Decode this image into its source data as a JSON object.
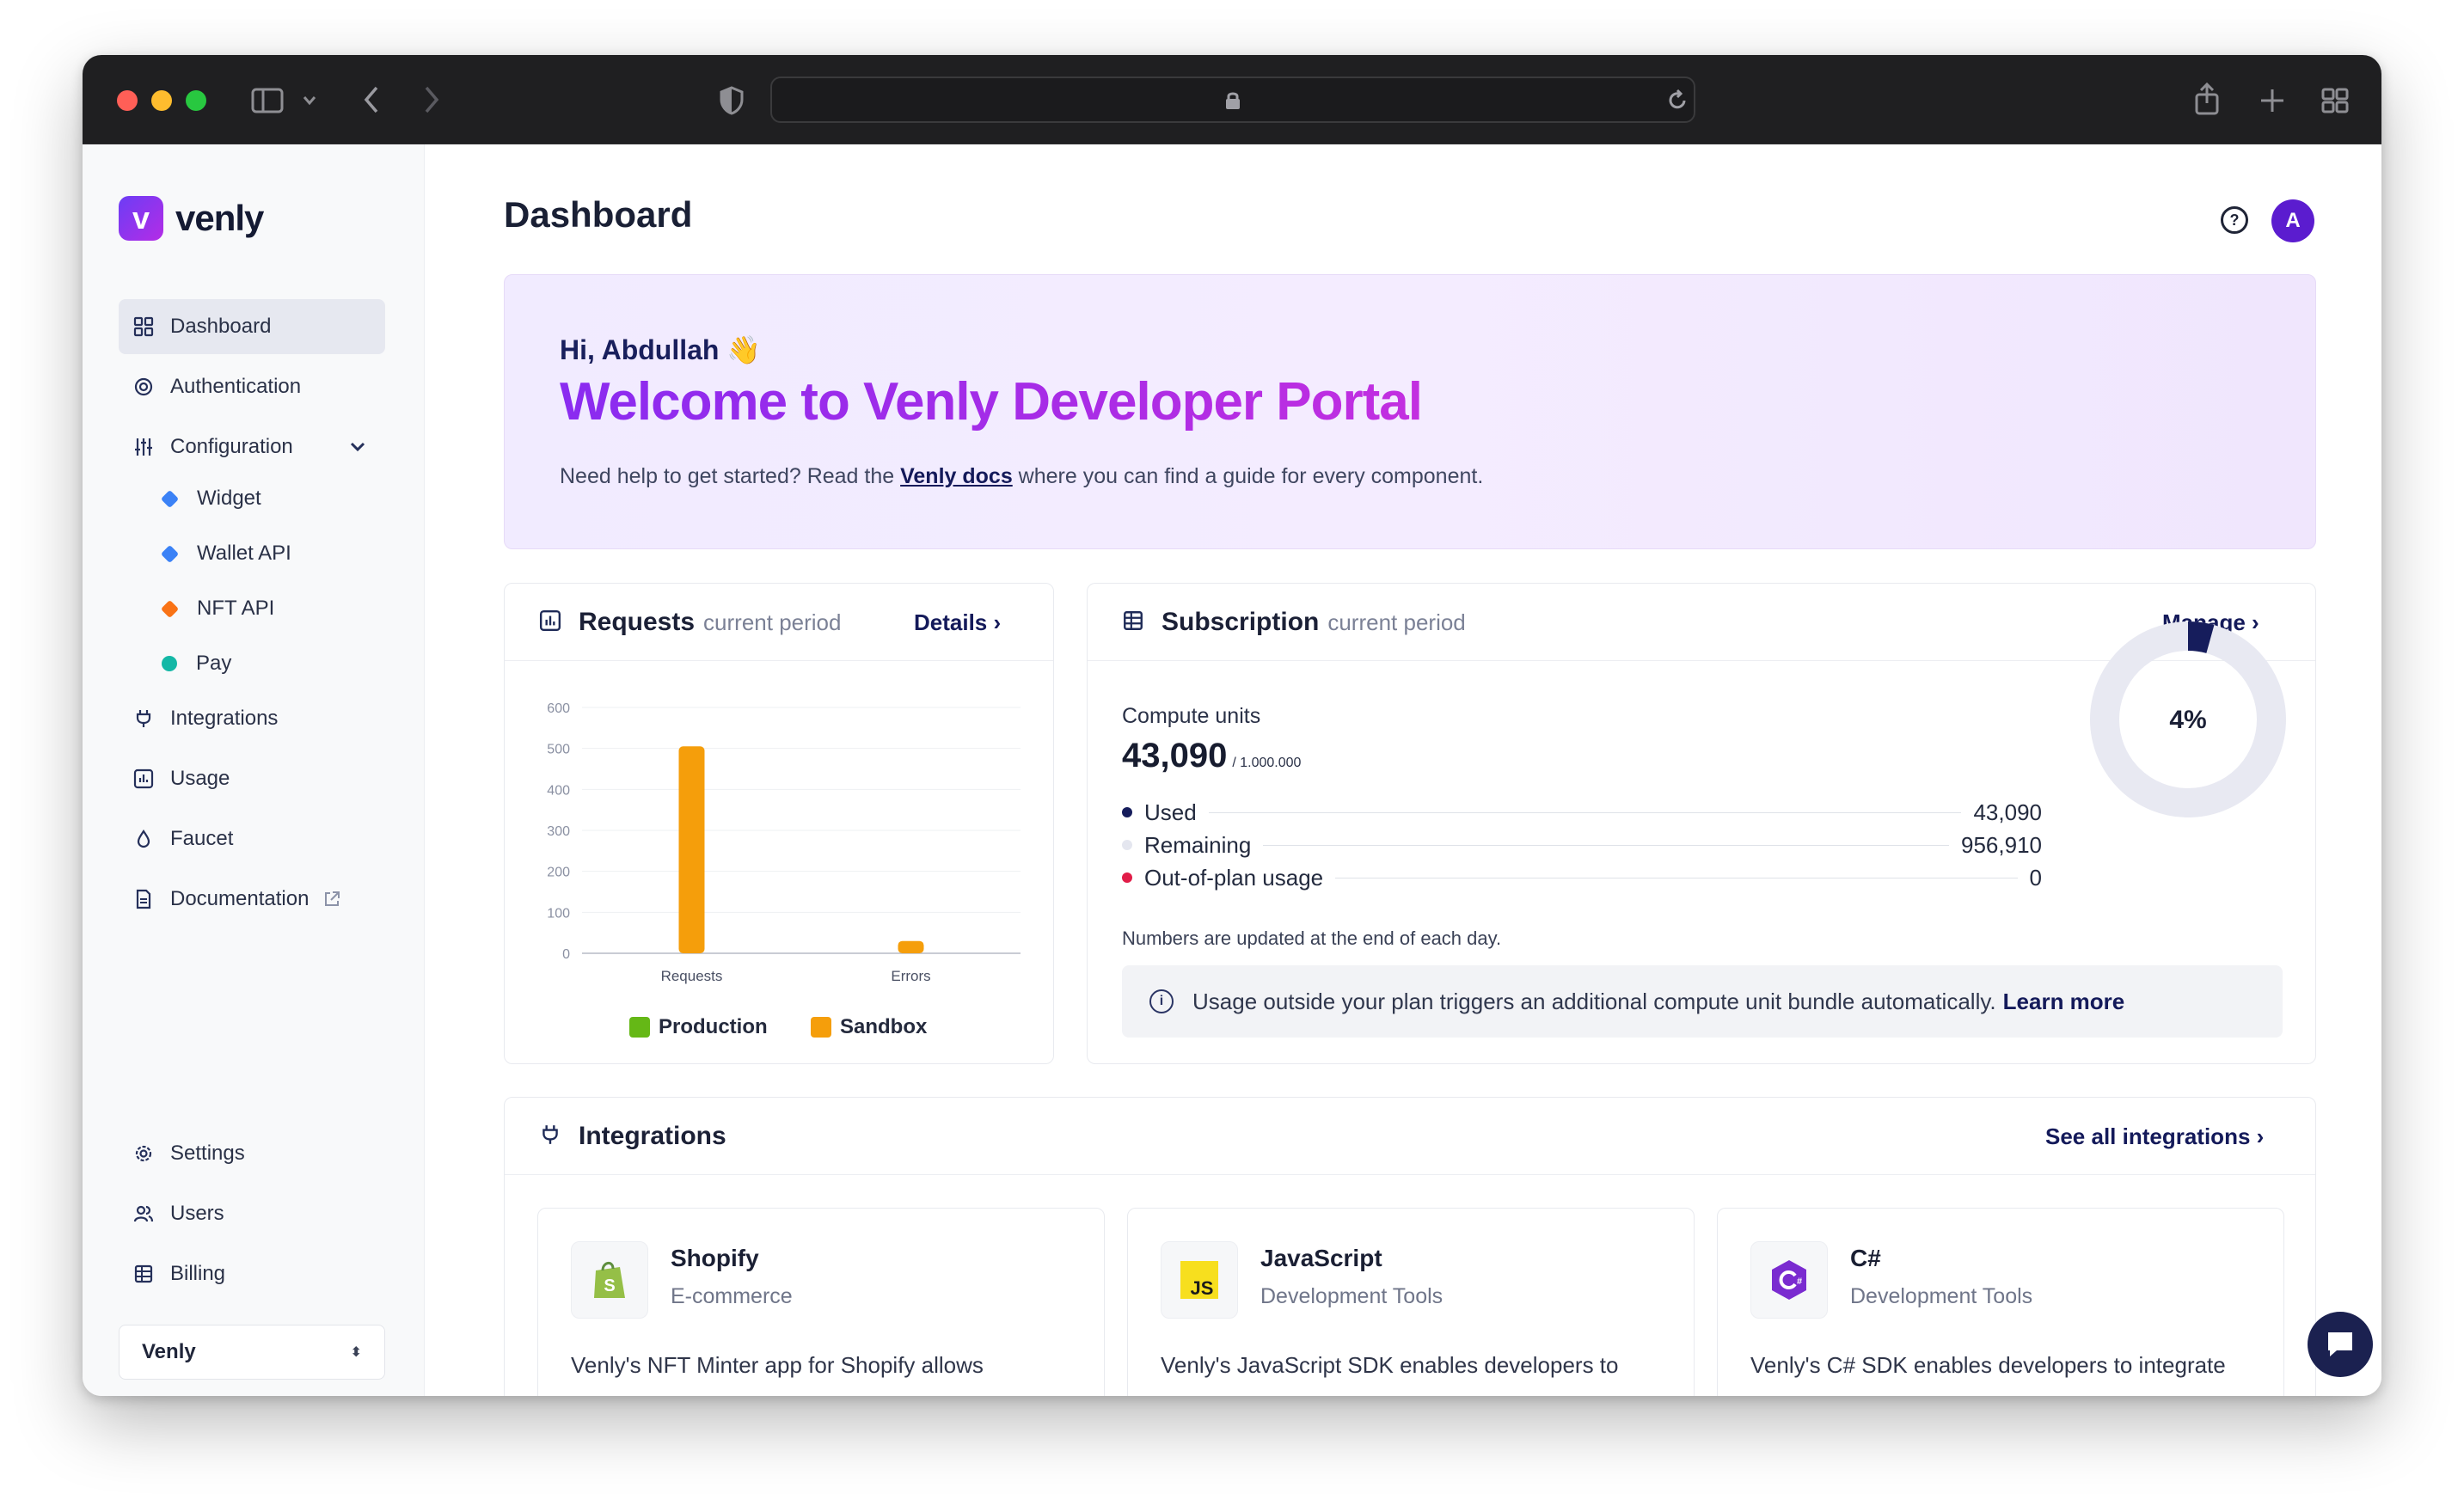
{
  "sidebar": {
    "brand": "venly",
    "items": [
      {
        "label": "Dashboard"
      },
      {
        "label": "Authentication"
      },
      {
        "label": "Configuration"
      },
      {
        "label": "Integrations"
      },
      {
        "label": "Usage"
      },
      {
        "label": "Faucet"
      },
      {
        "label": "Documentation"
      }
    ],
    "config_sub": [
      {
        "label": "Widget",
        "color": "#3b82f6"
      },
      {
        "label": "Wallet API",
        "color": "#3b82f6"
      },
      {
        "label": "NFT API",
        "color": "#f97316"
      },
      {
        "label": "Pay",
        "color": "#14b8a6"
      }
    ],
    "bottom_items": [
      {
        "label": "Settings"
      },
      {
        "label": "Users"
      },
      {
        "label": "Billing"
      }
    ],
    "org_select": "Venly"
  },
  "header": {
    "title": "Dashboard",
    "avatar_initial": "A"
  },
  "hero": {
    "greeting": "Hi, Abdullah 👋",
    "title": "Welcome to Venly Developer Portal",
    "sub_before": "Need help to get started? Read the ",
    "sub_link": "Venly docs",
    "sub_after": " where you can find a guide for every component."
  },
  "requests": {
    "title": "Requests",
    "subtitle": "current period",
    "link": "Details"
  },
  "chart_data": {
    "type": "bar",
    "categories": [
      "Requests",
      "Errors"
    ],
    "series": [
      {
        "name": "Production",
        "color": "#65b816",
        "values": [
          0,
          0
        ]
      },
      {
        "name": "Sandbox",
        "color": "#f59e0b",
        "values": [
          505,
          30
        ]
      }
    ],
    "yticks": [
      0,
      100,
      200,
      300,
      400,
      500,
      600
    ],
    "ylim": [
      0,
      600
    ]
  },
  "subscription": {
    "title": "Subscription",
    "subtitle": "current period",
    "link": "Manage",
    "cu_label": "Compute units",
    "cu_value": "43,090",
    "cu_total": "/ 1.000.000",
    "rows": [
      {
        "label": "Used",
        "value": "43,090",
        "color": "#161d5c"
      },
      {
        "label": "Remaining",
        "value": "956,910",
        "color": "#e4e6ef"
      },
      {
        "label": "Out-of-plan usage",
        "value": "0",
        "color": "#e11d48"
      }
    ],
    "donut_percent": "4%",
    "donut_fraction": 0.043,
    "note": "Numbers are updated at the end of each day.",
    "info": "Usage outside your plan triggers an additional compute unit bundle automatically.",
    "info_link": "Learn more"
  },
  "integrations": {
    "title": "Integrations",
    "link": "See all integrations",
    "cards": [
      {
        "name": "Shopify",
        "category": "E-commerce",
        "desc": "Venly's NFT Minter app for Shopify allows"
      },
      {
        "name": "JavaScript",
        "category": "Development Tools",
        "desc": "Venly's JavaScript SDK enables developers to"
      },
      {
        "name": "C#",
        "category": "Development Tools",
        "desc": "Venly's C# SDK enables developers to integrate"
      }
    ]
  }
}
